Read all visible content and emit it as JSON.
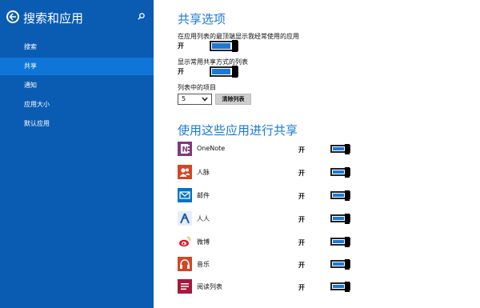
{
  "sidebar": {
    "title": "搜索和应用",
    "items": [
      {
        "label": "搜索"
      },
      {
        "label": "共享"
      },
      {
        "label": "通知"
      },
      {
        "label": "应用大小"
      },
      {
        "label": "默认应用"
      }
    ],
    "selected_index": 1
  },
  "share_options": {
    "heading": "共享选项",
    "frequent_apps_label": "在应用列表的最顶端显示我经常使用的应用",
    "frequent_apps_state": "开",
    "show_methods_label": "显示常用共享方式的列表",
    "show_methods_state": "开",
    "list_items_label": "列表中的项目",
    "list_items_value": "5",
    "clear_list_label": "清除列表"
  },
  "apps_section": {
    "heading": "使用这些应用进行共享",
    "apps": [
      {
        "name": "OneNote",
        "state": "开",
        "icon": "onenote-icon",
        "color": "#80397b"
      },
      {
        "name": "人脉",
        "state": "开",
        "icon": "people-icon",
        "color": "#d24726"
      },
      {
        "name": "邮件",
        "state": "开",
        "icon": "mail-icon",
        "color": "#0072c6"
      },
      {
        "name": "人人",
        "state": "开",
        "icon": "renren-icon",
        "color": "#1a5aa8"
      },
      {
        "name": "微博",
        "state": "开",
        "icon": "weibo-icon",
        "color": "#e6162d"
      },
      {
        "name": "音乐",
        "state": "开",
        "icon": "music-icon",
        "color": "#d24726"
      },
      {
        "name": "阅读列表",
        "state": "开",
        "icon": "reading-list-icon",
        "color": "#a4193d"
      }
    ]
  },
  "colors": {
    "sidebar_bg": "#0a5cb2",
    "sidebar_selected": "#0e76d8",
    "accent": "#1a7ad8"
  }
}
